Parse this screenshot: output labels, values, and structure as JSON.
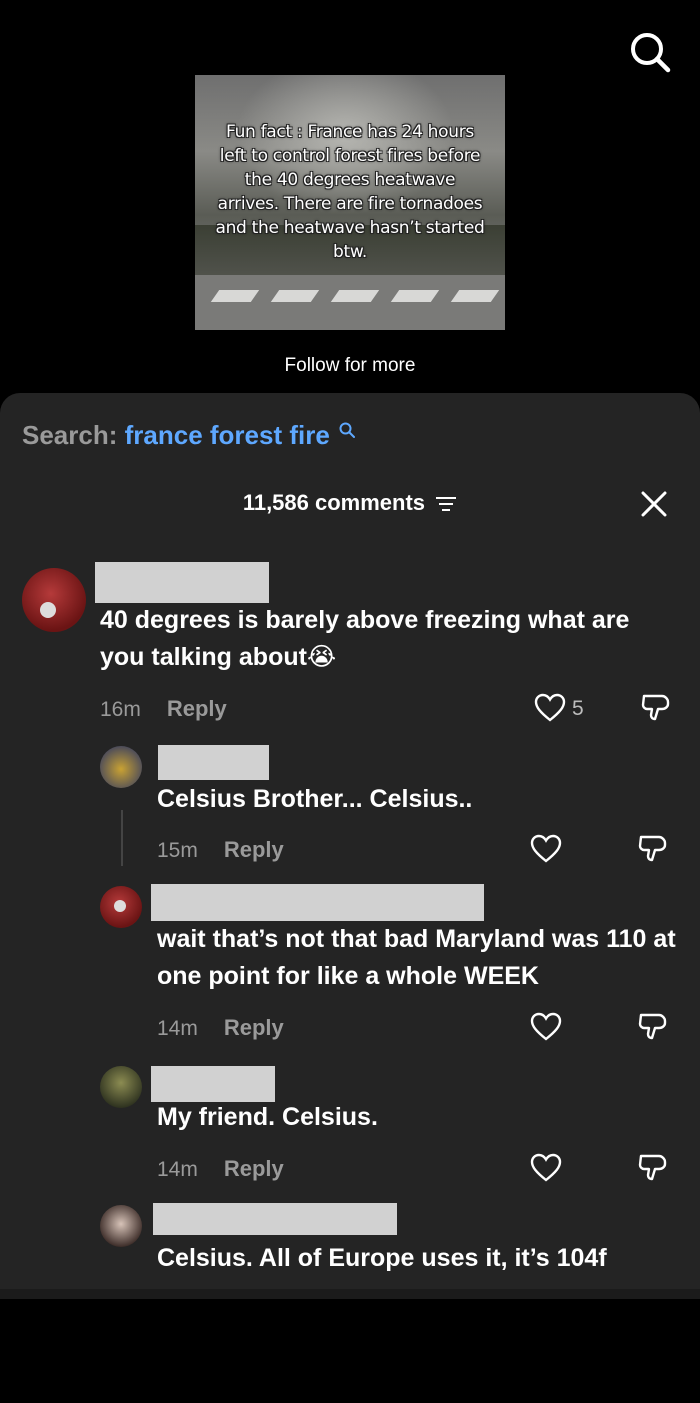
{
  "video": {
    "caption": "Fun fact : France has 24 hours left to control forest fires before the 40 degrees heatwave arrives. There are fire tornadoes and the heatwave hasn’t started btw.",
    "follow_text": "Follow for more"
  },
  "search": {
    "label": "Search:",
    "term": "france forest fire"
  },
  "comments_header": {
    "count_text": "11,586 comments"
  },
  "comments": [
    {
      "text": "40 degrees is barely above freezing what are you talking about😭",
      "time": "16m",
      "reply_label": "Reply",
      "likes": "5"
    },
    {
      "text": "Celsius Brother... Celsius..",
      "time": "15m",
      "reply_label": "Reply"
    },
    {
      "text": "wait that’s not that bad Maryland was 110 at one point for like a whole WEEK",
      "time": "14m",
      "reply_label": "Reply"
    },
    {
      "text": "My friend. Celsius.",
      "time": "14m",
      "reply_label": "Reply"
    },
    {
      "text": "Celsius. All of Europe uses it, it’s 104f"
    }
  ],
  "colors": {
    "background": "#000000",
    "panel": "#242424",
    "search_term": "#5ea8ff",
    "muted": "#9a9a9a"
  },
  "icons": [
    "search-icon",
    "filter-icon",
    "close-icon",
    "heart-icon",
    "dislike-icon"
  ]
}
